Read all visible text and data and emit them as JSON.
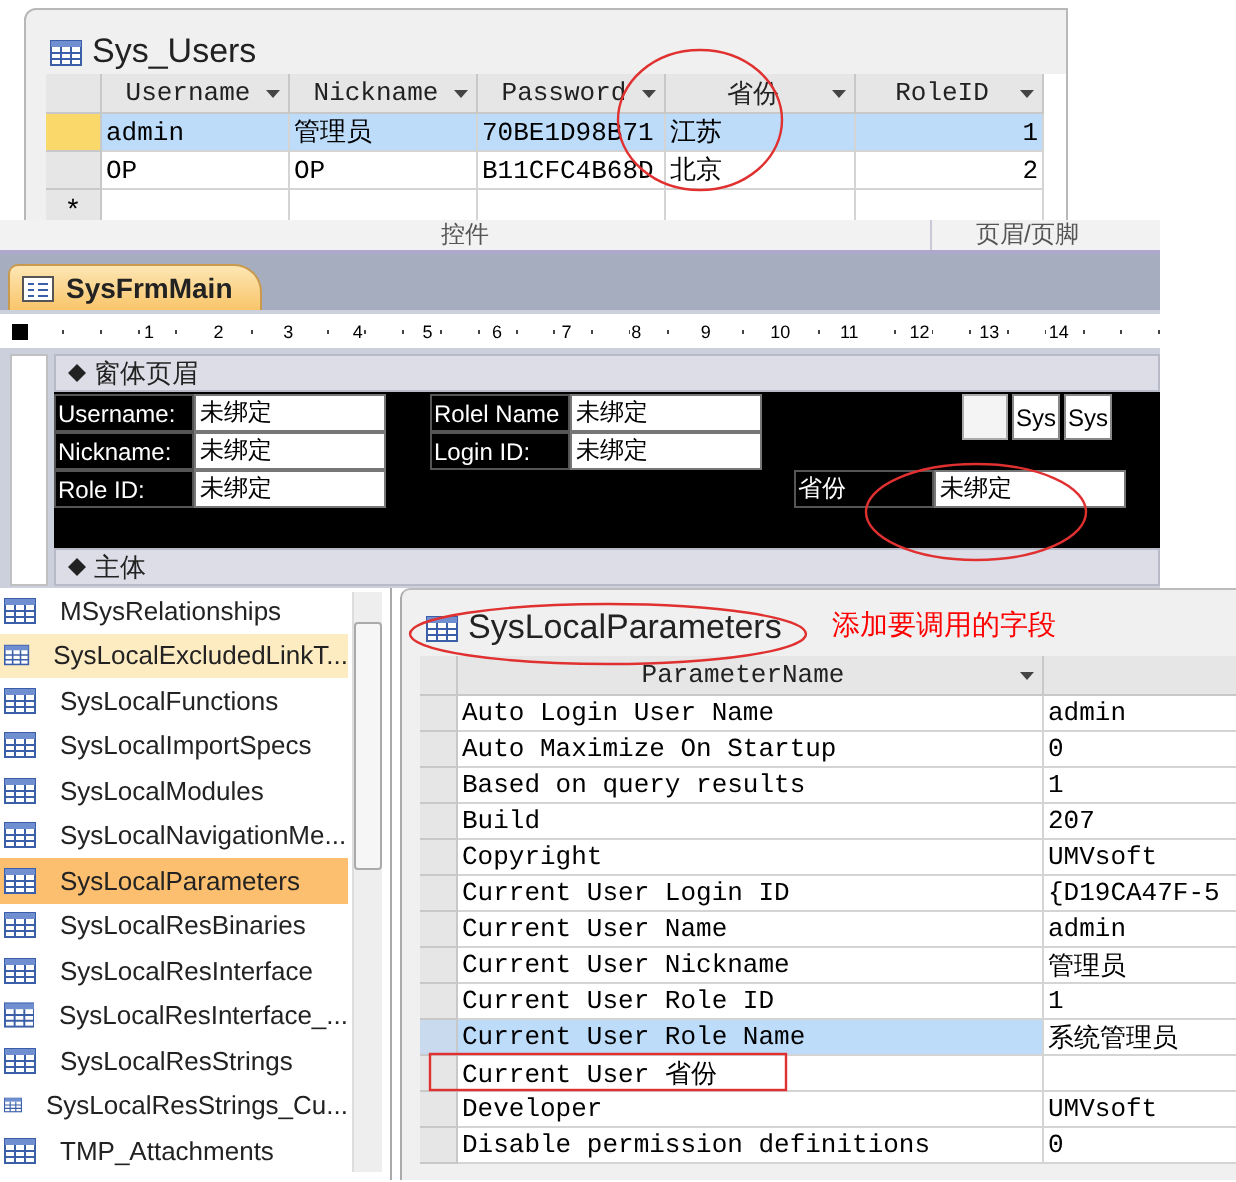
{
  "users_table": {
    "title": "Sys_Users",
    "columns": [
      "Username",
      "Nickname",
      "Password",
      "省份",
      "RoleID"
    ],
    "rows": [
      {
        "selected": true,
        "cells": [
          "admin",
          "管理员",
          "70BE1D98B71",
          "江苏",
          "1"
        ]
      },
      {
        "selected": false,
        "cells": [
          "OP",
          "OP",
          "B11CFC4B68D",
          "北京",
          "2"
        ]
      }
    ],
    "new_row_marker": "*"
  },
  "ribbon_groups": [
    "控件",
    "页眉/页脚"
  ],
  "form_designer": {
    "tab": "SysFrmMain",
    "ruler": [
      "1",
      "2",
      "3",
      "4",
      "5",
      "6",
      "7",
      "8",
      "9",
      "10",
      "11",
      "12",
      "13",
      "14"
    ],
    "header_section": "窗体页眉",
    "body_section": "主体",
    "controls": [
      {
        "label": "Username:",
        "value": "未绑定"
      },
      {
        "label": "Nickname:",
        "value": "未绑定"
      },
      {
        "label": "Role ID:",
        "value": "未绑定"
      },
      {
        "label": "Rolel Name",
        "value": "未绑定"
      },
      {
        "label": "Login ID:",
        "value": "未绑定"
      },
      {
        "label": "省份",
        "value": "未绑定"
      }
    ],
    "small_buttons": [
      "Sys",
      "Sys"
    ]
  },
  "navigation": {
    "items": [
      {
        "name": "MSysRelationships",
        "selected": false,
        "hovered": false
      },
      {
        "name": "SysLocalExcludedLinkT...",
        "selected": false,
        "hovered": true
      },
      {
        "name": "SysLocalFunctions",
        "selected": false,
        "hovered": false
      },
      {
        "name": "SysLocalImportSpecs",
        "selected": false,
        "hovered": false
      },
      {
        "name": "SysLocalModules",
        "selected": false,
        "hovered": false
      },
      {
        "name": "SysLocalNavigationMe...",
        "selected": false,
        "hovered": false
      },
      {
        "name": "SysLocalParameters",
        "selected": true,
        "hovered": false
      },
      {
        "name": "SysLocalResBinaries",
        "selected": false,
        "hovered": false
      },
      {
        "name": "SysLocalResInterface",
        "selected": false,
        "hovered": false
      },
      {
        "name": "SysLocalResInterface_...",
        "selected": false,
        "hovered": false
      },
      {
        "name": "SysLocalResStrings",
        "selected": false,
        "hovered": false
      },
      {
        "name": "SysLocalResStrings_Cu...",
        "selected": false,
        "hovered": false
      },
      {
        "name": "TMP_Attachments",
        "selected": false,
        "hovered": false
      }
    ]
  },
  "parameters_table": {
    "title": "SysLocalParameters",
    "columns": [
      "ParameterName"
    ],
    "rows": [
      {
        "name": "Auto Login User Name",
        "value": "admin",
        "selected": false
      },
      {
        "name": "Auto Maximize On Startup",
        "value": "0",
        "selected": false
      },
      {
        "name": "Based on query results",
        "value": "1",
        "selected": false
      },
      {
        "name": "Build",
        "value": "207",
        "selected": false
      },
      {
        "name": "Copyright",
        "value": "UMVsoft",
        "selected": false
      },
      {
        "name": "Current User Login ID",
        "value": "{D19CA47F-5",
        "selected": false
      },
      {
        "name": "Current User Name",
        "value": "admin",
        "selected": false
      },
      {
        "name": "Current User Nickname",
        "value": "管理员",
        "selected": false
      },
      {
        "name": "Current User Role ID",
        "value": "1",
        "selected": false
      },
      {
        "name": "Current User Role Name",
        "value": "系统管理员",
        "selected": true
      },
      {
        "name": "Current User 省份",
        "value": "",
        "selected": false
      },
      {
        "name": "Developer",
        "value": "UMVsoft",
        "selected": false
      },
      {
        "name": "Disable permission definitions",
        "value": "0",
        "selected": false
      }
    ]
  },
  "annotation": "添加要调用的字段"
}
